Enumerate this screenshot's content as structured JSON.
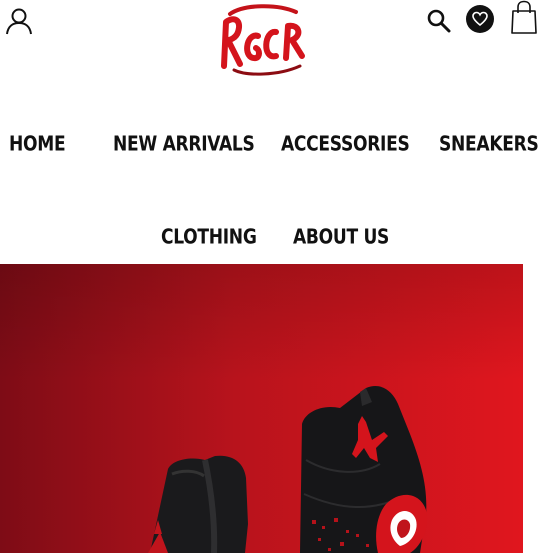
{
  "header": {
    "icons": [
      "user-icon",
      "search-icon",
      "heart-icon",
      "shopping-bag-icon"
    ]
  },
  "nav": {
    "items": [
      {
        "label": "HOME"
      },
      {
        "label": "NEW ARRIVALS"
      },
      {
        "label": "ACCESSORIES"
      },
      {
        "label": "SNEAKERS"
      },
      {
        "label": "CLOTHING"
      },
      {
        "label": "ABOUT US"
      }
    ]
  },
  "colors": {
    "brand_red": "#d4141c",
    "hero_dark": "#7a0a14",
    "text": "#111111"
  }
}
